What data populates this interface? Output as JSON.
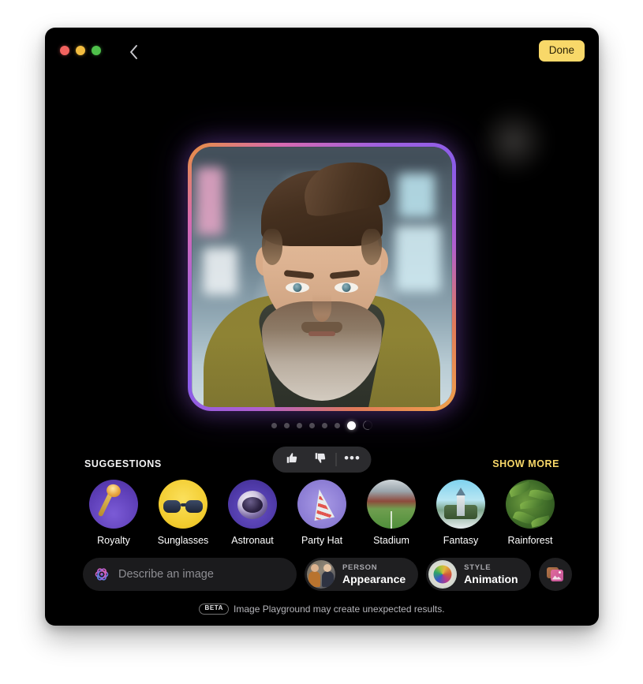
{
  "window": {
    "traffic_lights": [
      "close",
      "minimize",
      "maximize"
    ],
    "back_icon": "chevron-left-icon",
    "done_label": "Done"
  },
  "generated_image": {
    "alt": "Animation-style portrait of a bearded man with a pompadour hairstyle wearing an olive jacket",
    "carousel": {
      "total_dots": 6,
      "active_index": 6,
      "loading": true
    }
  },
  "feedback": {
    "thumbs_up_icon": "thumbs-up-icon",
    "thumbs_down_icon": "thumbs-down-icon",
    "more_label": "•••"
  },
  "suggestions": {
    "title": "SUGGESTIONS",
    "show_more_label": "SHOW MORE",
    "items": [
      {
        "label": "Royalty",
        "art": "royalty"
      },
      {
        "label": "Sunglasses",
        "art": "sunglasses"
      },
      {
        "label": "Astronaut",
        "art": "astronaut"
      },
      {
        "label": "Party Hat",
        "art": "party-hat"
      },
      {
        "label": "Stadium",
        "art": "stadium"
      },
      {
        "label": "Fantasy",
        "art": "fantasy"
      },
      {
        "label": "Rainforest",
        "art": "rainforest"
      }
    ]
  },
  "prompt": {
    "icon": "apple-intelligence-icon",
    "placeholder": "Describe an image",
    "value": ""
  },
  "chips": [
    {
      "kicker": "PERSON",
      "value": "Appearance",
      "thumb": "person-photo-thumb"
    },
    {
      "kicker": "STYLE",
      "value": "Animation",
      "thumb": "style-sphere-thumb"
    }
  ],
  "photo_button": {
    "icon": "photo-library-icon"
  },
  "footer": {
    "badge": "BETA",
    "text": "Image Playground may create unexpected results."
  },
  "colors": {
    "accent_yellow": "#f8d869",
    "window_background": "#000000",
    "page_background": "#ffffff",
    "chip_background": "#1f1f21",
    "placeholder_text": "#8e8e93"
  }
}
